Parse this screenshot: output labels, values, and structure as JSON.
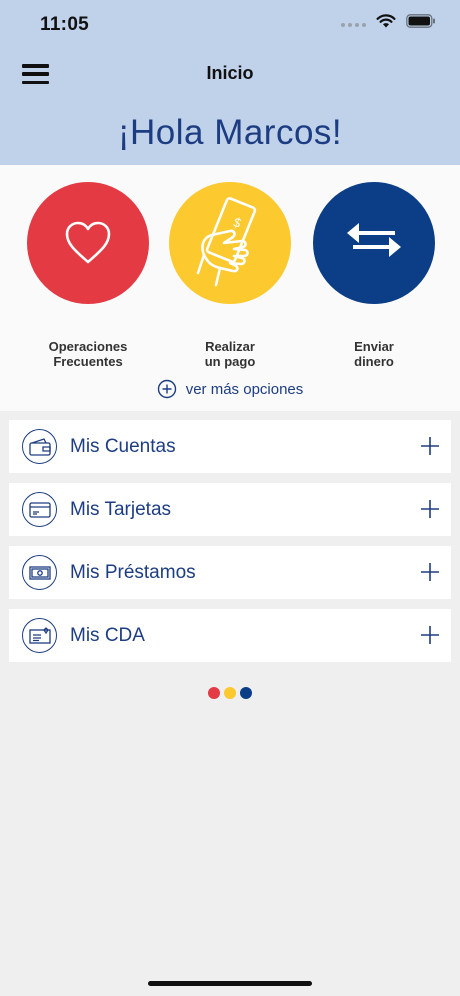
{
  "status_bar": {
    "time": "11:05"
  },
  "nav": {
    "title": "Inicio"
  },
  "greeting": "¡Hola Marcos!",
  "quick_actions": [
    {
      "label": "Operaciones\nFrecuentes",
      "icon": "heart-icon",
      "color": "#e33a44"
    },
    {
      "label": "Realizar\nun pago",
      "icon": "hand-money-icon",
      "color": "#fcc92f"
    },
    {
      "label": "Enviar\ndinero",
      "icon": "transfer-arrows-icon",
      "color": "#0b3e87"
    }
  ],
  "more_options": "ver más opciones",
  "sections": [
    {
      "label": "Mis Cuentas",
      "icon": "wallet-icon"
    },
    {
      "label": "Mis Tarjetas",
      "icon": "card-icon"
    },
    {
      "label": "Mis Préstamos",
      "icon": "cash-icon"
    },
    {
      "label": "Mis CDA",
      "icon": "certificate-icon"
    }
  ],
  "brand_dots": [
    "#e33a44",
    "#fcc92f",
    "#0b3e87"
  ],
  "colors": {
    "header_bg": "#c0d1ea",
    "primary": "#1d3d82"
  }
}
